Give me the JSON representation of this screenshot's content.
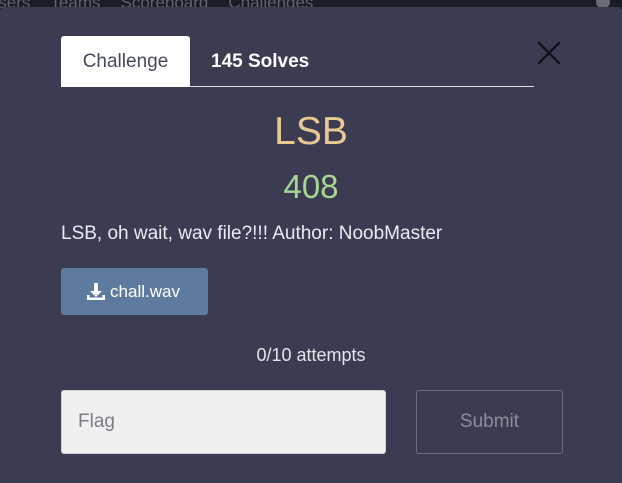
{
  "background_nav": {
    "items": [
      "Users",
      "Teams",
      "Scoreboard",
      "Challenges"
    ]
  },
  "modal": {
    "tabs": [
      {
        "label": "Challenge",
        "active": true
      },
      {
        "label": "145 Solves",
        "active": false
      }
    ],
    "close_icon": "close-icon",
    "challenge": {
      "name": "LSB",
      "points": "408",
      "description": "LSB, oh wait, wav file?!!! Author: NoobMaster",
      "file": {
        "label": "chall.wav",
        "icon": "download-icon"
      },
      "attempts": "0/10 attempts"
    },
    "flag_form": {
      "placeholder": "Flag",
      "value": "",
      "submit_label": "Submit"
    }
  },
  "colors": {
    "modal_bg": "#3b3c51",
    "title": "#e8c995",
    "points": "#a6d693",
    "download_button": "#5d7b9f"
  }
}
